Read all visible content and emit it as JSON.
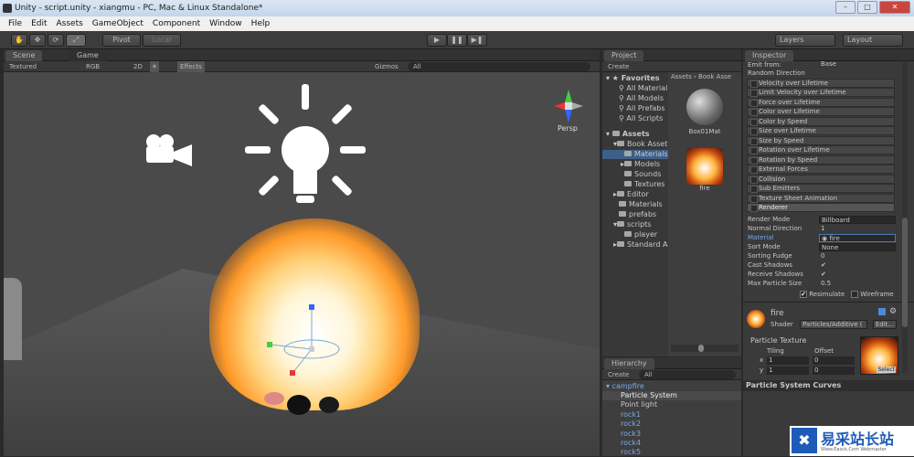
{
  "window": {
    "title": "Unity - script.unity - xiangmu - PC, Mac & Linux Standalone*",
    "min": "–",
    "max": "□",
    "close": "✕"
  },
  "menu": [
    "File",
    "Edit",
    "Assets",
    "GameObject",
    "Component",
    "Window",
    "Help"
  ],
  "toolbar": {
    "tools": [
      "✋",
      "✥",
      "⟳",
      "⤢"
    ],
    "pivot": "Pivot",
    "local": "Local",
    "play": "▶",
    "pause": "❚❚",
    "step": "▶❚",
    "layers": "Layers",
    "layout": "Layout"
  },
  "scene": {
    "tab_scene": "Scene",
    "tab_game": "Game",
    "mode": "Textured",
    "color": "RGB",
    "dim": "2D",
    "effects": "Effects",
    "gizmos": "Gizmos",
    "search": "All",
    "persp": "Persp"
  },
  "project": {
    "tab": "Project",
    "create": "Create",
    "breadcrumb": "Assets › Book Asse",
    "favorites": "Favorites",
    "fav_items": [
      "All Material",
      "All Models",
      "All Prefabs",
      "All Scripts"
    ],
    "assets": "Assets",
    "tree": [
      {
        "label": "Book Asset",
        "indent": 1
      },
      {
        "label": "Materials",
        "indent": 2
      },
      {
        "label": "Models",
        "indent": 2
      },
      {
        "label": "Sounds",
        "indent": 2
      },
      {
        "label": "Textures",
        "indent": 2
      },
      {
        "label": "Editor",
        "indent": 1
      },
      {
        "label": "Materials",
        "indent": 1
      },
      {
        "label": "prefabs",
        "indent": 1
      },
      {
        "label": "scripts",
        "indent": 1
      },
      {
        "label": "player",
        "indent": 2
      },
      {
        "label": "Standard A",
        "indent": 1
      }
    ],
    "grid": [
      {
        "label": "Box01Mat"
      },
      {
        "label": "fire"
      }
    ]
  },
  "hierarchy": {
    "tab": "Hierarchy",
    "create": "Create",
    "search": "All",
    "items": [
      "campfire",
      "Particle System",
      "Point light",
      "rock1",
      "rock2",
      "rock3",
      "rock4",
      "rock5"
    ]
  },
  "inspector": {
    "tab": "Inspector",
    "emit_from": "Emit from:",
    "emit_val": "Base",
    "random_dir": "Random Direction",
    "modules": [
      "Velocity over Lifetime",
      "Limit Velocity over Lifetime",
      "Force over Lifetime",
      "Color over Lifetime",
      "Color by Speed",
      "Size over Lifetime",
      "Size by Speed",
      "Rotation over Lifetime",
      "Rotation by Speed",
      "External Forces",
      "Collision",
      "Sub Emitters",
      "Texture Sheet Animation"
    ],
    "renderer": "Renderer",
    "props": [
      {
        "k": "Render Mode",
        "v": "Billboard"
      },
      {
        "k": "Normal Direction",
        "v": "1"
      },
      {
        "k": "Material",
        "v": "fire"
      },
      {
        "k": "Sort Mode",
        "v": "None"
      },
      {
        "k": "Sorting Fudge",
        "v": "0"
      },
      {
        "k": "Cast Shadows",
        "v": "✔"
      },
      {
        "k": "Receive Shadows",
        "v": "✔"
      },
      {
        "k": "Max Particle Size",
        "v": "0.5"
      }
    ],
    "resimulate": "Resimulate",
    "wireframe": "Wireframe",
    "mat_name": "fire",
    "shader_label": "Shader",
    "shader_val": "Particles/Additive (",
    "edit": "Edit...",
    "particle_texture": "Particle Texture",
    "tiling": "Tiling",
    "offset": "Offset",
    "x": "x",
    "y": "y",
    "tx": "1",
    "ty": "1",
    "ox": "0",
    "oy": "0",
    "select": "Select",
    "curves": "Particle System Curves"
  },
  "watermark": {
    "text": "易采站长站",
    "sub": "Www.Easck.Com Webmaster"
  },
  "colors": {
    "accent": "#3d6ea8",
    "selected": "#3e5f8a",
    "link": "#7aa9e8"
  }
}
